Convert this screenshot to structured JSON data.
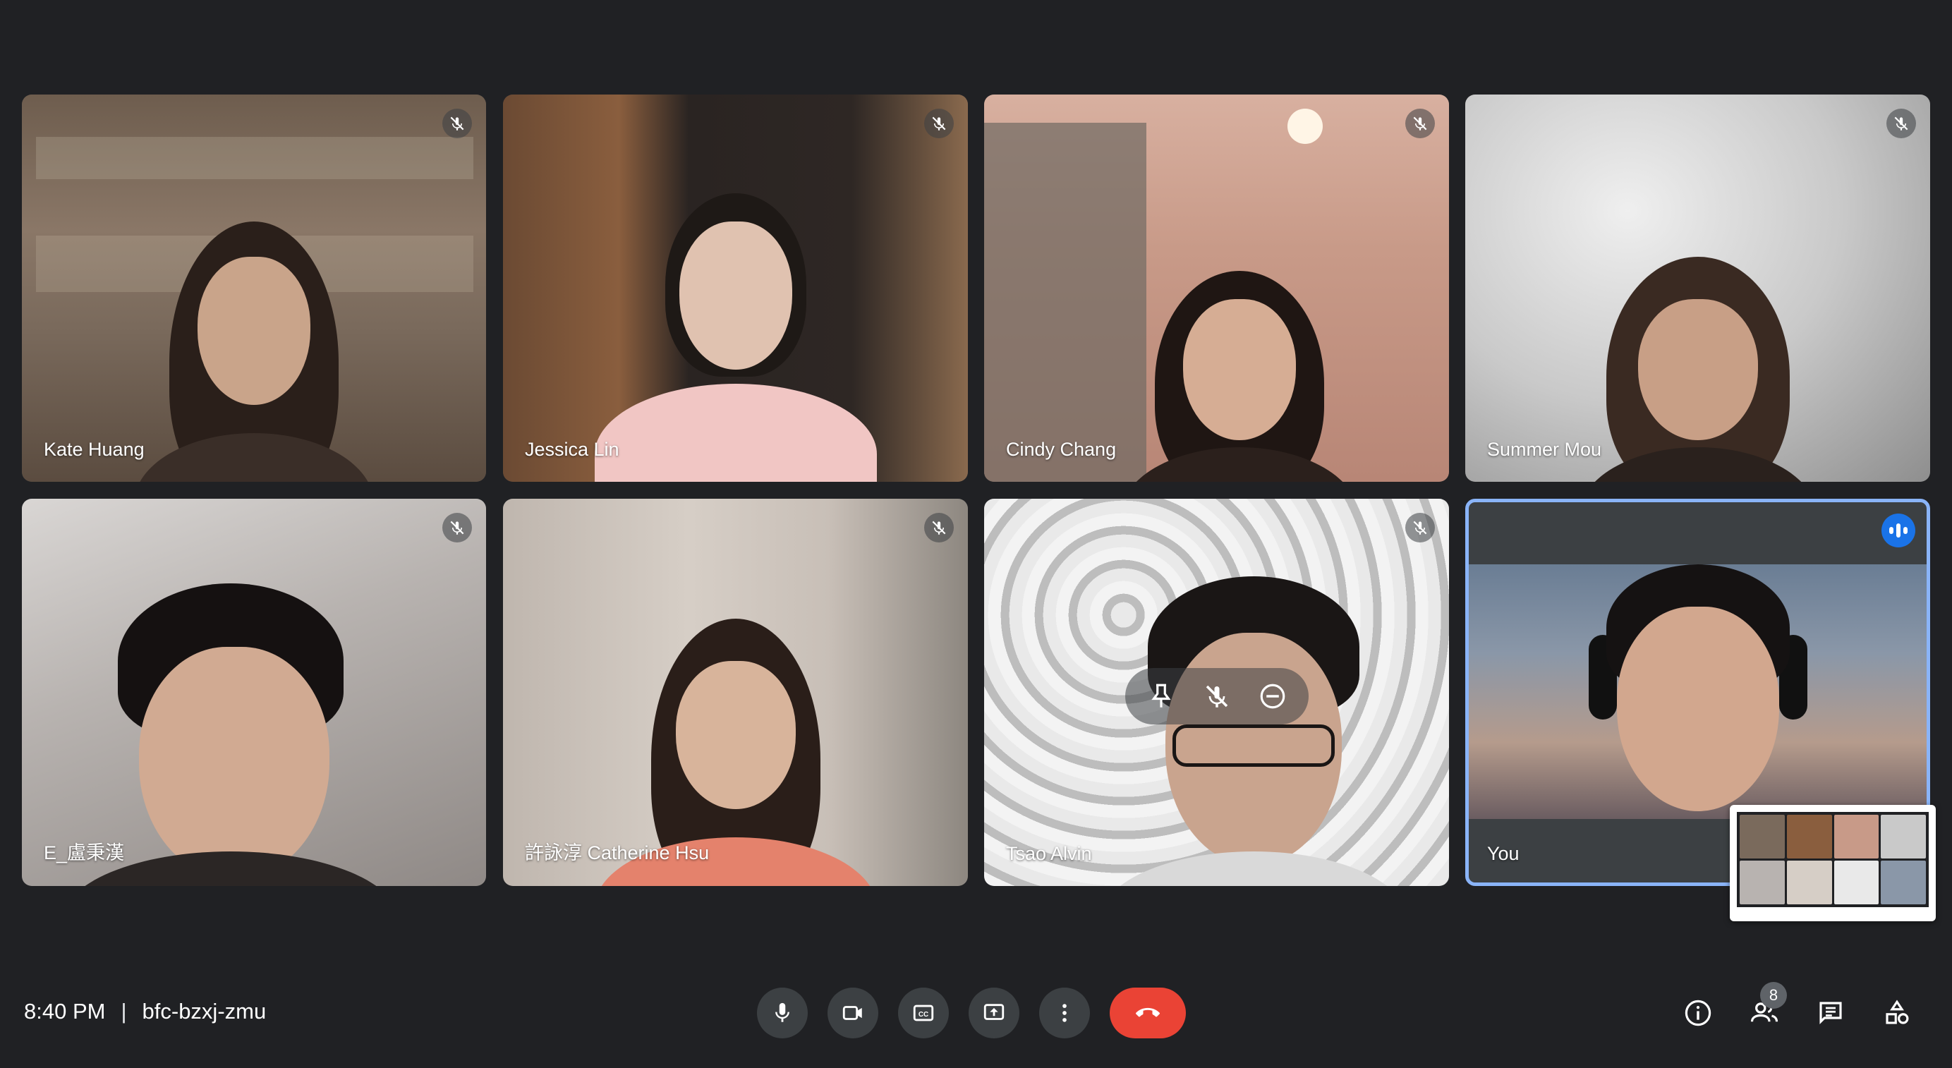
{
  "participants": [
    {
      "name": "Kate Huang",
      "muted": true
    },
    {
      "name": "Jessica Lin",
      "muted": true
    },
    {
      "name": "Cindy Chang",
      "muted": true
    },
    {
      "name": "Summer Mou",
      "muted": true
    },
    {
      "name": "E_盧秉漢",
      "muted": true
    },
    {
      "name": "許詠淳 Catherine Hsu",
      "muted": true
    },
    {
      "name": "Tsao Alvin",
      "muted": true
    },
    {
      "name": "You",
      "muted": false,
      "speaking": true
    }
  ],
  "meeting": {
    "time": "8:40 PM",
    "separator": "|",
    "code": "bfc-bzxj-zmu"
  },
  "people_count": "8",
  "icons": {
    "tile_mute": "mic-off-icon",
    "speaking": "audio-level-icon",
    "pin": "pin-icon",
    "mute_participant": "mic-off-icon",
    "remove": "remove-circle-icon",
    "mic": "mic-icon",
    "camera": "videocam-icon",
    "captions": "closed-caption-icon",
    "present": "present-screen-icon",
    "more": "more-vert-icon",
    "hangup": "call-end-icon",
    "info": "info-icon",
    "people": "people-icon",
    "chat": "chat-icon",
    "activities": "shapes-icon"
  },
  "colors": {
    "background": "#202124",
    "control_bg": "#3c4043",
    "hangup": "#ea4335",
    "active_border": "#8ab4f8",
    "speaking_badge": "#1a73e8"
  }
}
